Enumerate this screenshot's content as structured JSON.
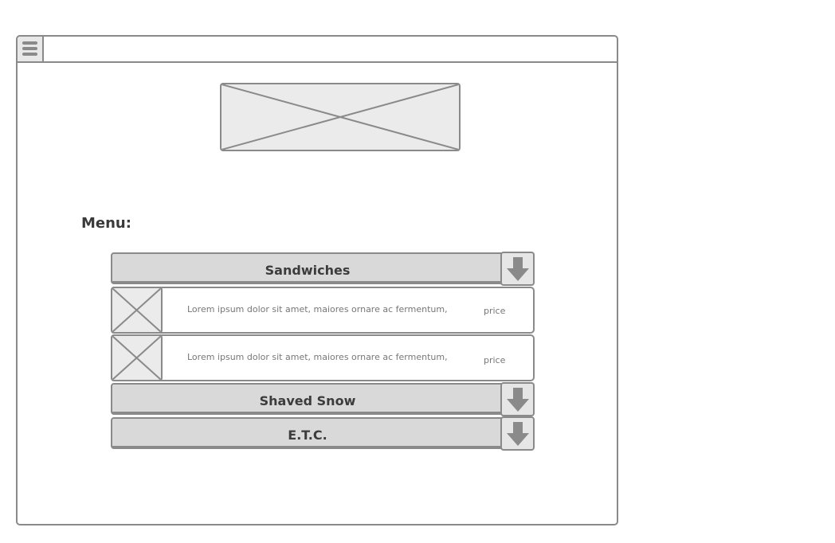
{
  "window": {
    "menu_icon": "hamburger-menu-icon",
    "hero_image": "image-placeholder"
  },
  "menu": {
    "heading": "Menu:",
    "categories": [
      {
        "label": "Sandwiches",
        "toggle_icon": "arrow-down-icon",
        "expanded": true,
        "items": [
          {
            "description": "Lorem ipsum dolor sit amet, maiores ornare ac fermentum,",
            "price": "price",
            "image": "image-placeholder"
          },
          {
            "description": "Lorem ipsum dolor sit amet, maiores ornare ac fermentum,",
            "price": "price",
            "image": "image-placeholder"
          }
        ]
      },
      {
        "label": "Shaved Snow",
        "toggle_icon": "arrow-down-icon",
        "expanded": false
      },
      {
        "label": "E.T.C.",
        "toggle_icon": "arrow-down-icon",
        "expanded": false
      }
    ]
  },
  "colors": {
    "border": "#8a8a8a",
    "bar_fill": "#d9d9d9",
    "placeholder_fill": "#ebebeb",
    "text_dark": "#3c3c3c",
    "text_muted": "#777777"
  }
}
